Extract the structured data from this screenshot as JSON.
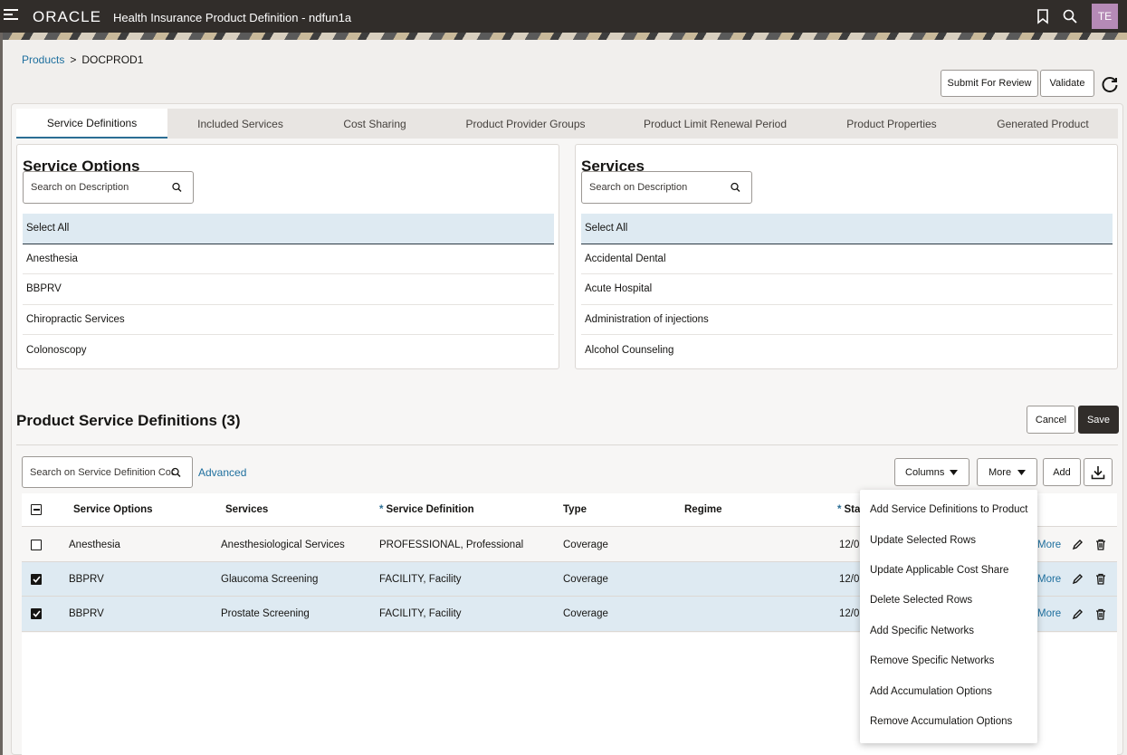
{
  "header": {
    "brand": "ORACLE",
    "app_title": "Health Insurance Product Definition - ndfun1a",
    "avatar_initials": "TE"
  },
  "breadcrumb": {
    "root": "Products",
    "separator": ">",
    "current": "DOCPROD1"
  },
  "actions": {
    "submit_for_review": "Submit For Review",
    "validate": "Validate"
  },
  "tabs": [
    {
      "label": "Service Definitions",
      "active": true
    },
    {
      "label": "Included Services"
    },
    {
      "label": "Cost Sharing"
    },
    {
      "label": "Product Provider Groups"
    },
    {
      "label": "Product Limit Renewal Period"
    },
    {
      "label": "Product Properties"
    },
    {
      "label": "Generated Product"
    }
  ],
  "service_options": {
    "title": "Service Options",
    "search_placeholder": "Search on Description",
    "items": [
      "Select All",
      "Anesthesia",
      "BBPRV",
      "Chiropractic Services",
      "Colonoscopy"
    ]
  },
  "services": {
    "title": "Services",
    "search_placeholder": "Search on Description",
    "items": [
      "Select All",
      "Accidental Dental",
      "Acute Hospital",
      "Administration of injections",
      "Alcohol Counseling"
    ]
  },
  "psd": {
    "title": "Product Service Definitions (3)",
    "cancel": "Cancel",
    "save": "Save",
    "search_placeholder": "Search on Service Definition Code",
    "advanced": "Advanced",
    "columns_btn": "Columns",
    "more_btn": "More",
    "add_btn": "Add"
  },
  "table": {
    "headers": {
      "service_options": "Service Options",
      "services": "Services",
      "service_definition": "Service Definition",
      "type": "Type",
      "regime": "Regime",
      "start_partial": "Sta"
    },
    "rows": [
      {
        "selected": false,
        "service_option": "Anesthesia",
        "service": "Anesthesiological Services",
        "definition": "PROFESSIONAL, Professional",
        "type": "Coverage",
        "regime": "",
        "start_partial": "12/0",
        "more": "More"
      },
      {
        "selected": true,
        "service_option": "BBPRV",
        "service": "Glaucoma Screening",
        "definition": "FACILITY, Facility",
        "type": "Coverage",
        "regime": "",
        "start_partial": "12/0",
        "more": "More"
      },
      {
        "selected": true,
        "service_option": "BBPRV",
        "service": "Prostate Screening",
        "definition": "FACILITY, Facility",
        "type": "Coverage",
        "regime": "",
        "start_partial": "12/0",
        "more": "More"
      }
    ]
  },
  "more_menu": [
    "Add Service Definitions to Product",
    "Update Selected Rows",
    "Update Applicable Cost Share",
    "Delete Selected Rows",
    "Add Specific Networks",
    "Remove Specific Networks",
    "Add Accumulation Options",
    "Remove Accumulation Options"
  ]
}
